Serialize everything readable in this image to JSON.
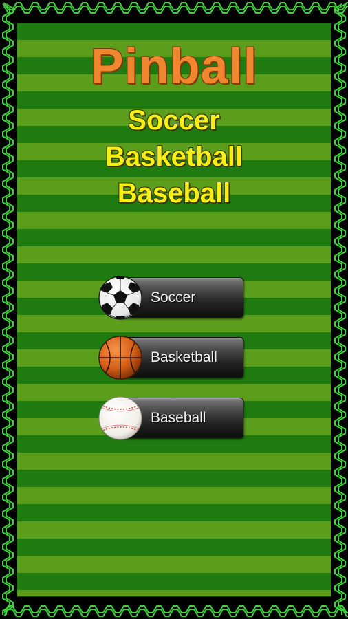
{
  "title": "Pinball",
  "subtitles": [
    "Soccer",
    "Basketball",
    "Baseball"
  ],
  "menu": [
    {
      "label": "Soccer",
      "icon": "soccer-ball-icon"
    },
    {
      "label": "Basketball",
      "icon": "basketball-icon"
    },
    {
      "label": "Baseball",
      "icon": "baseball-icon"
    }
  ],
  "colors": {
    "title": "#f0862e",
    "subtitle": "#f7ef13",
    "field_dark": "#1f7a10",
    "field_light": "#5a9e1c",
    "frame_line": "#3fd13a",
    "button_text": "#f2f2f2"
  }
}
